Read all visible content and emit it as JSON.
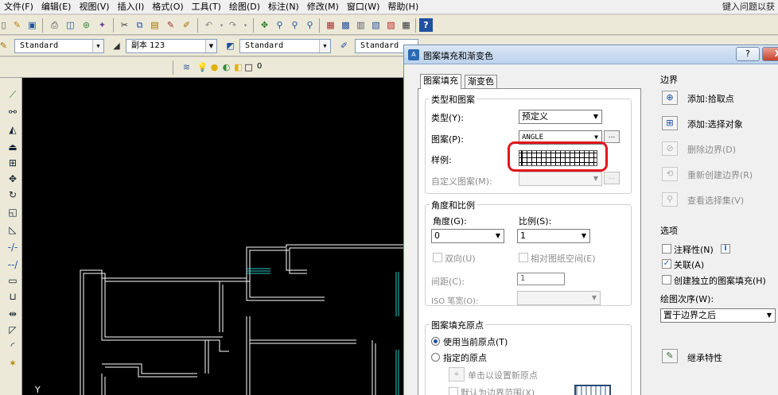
{
  "menu": [
    "文件(F)",
    "编辑(E)",
    "视图(V)",
    "插入(I)",
    "格式(O)",
    "工具(T)",
    "绘图(D)",
    "标注(N)",
    "修改(M)",
    "窗口(W)",
    "帮助(H)"
  ],
  "help_search": "键入问题以获",
  "toolbar2": {
    "text_style": "Standard",
    "dim_style": "副本 123",
    "table_style": "Standard",
    "ml_style": "Standard"
  },
  "layer": {
    "name": "0"
  },
  "canvas": {
    "ucs_label": "Y"
  },
  "dialog": {
    "title": "图案填充和渐变色",
    "help_btn": "?",
    "close_btn": "X",
    "tabs": [
      "图案填充",
      "渐变色"
    ],
    "type_group": {
      "title": "类型和图案",
      "type_label": "类型(Y):",
      "type_value": "预定义",
      "pattern_label": "图案(P):",
      "pattern_value": "ANGLE",
      "browse": "...",
      "sample_label": "样例:",
      "custom_label": "自定义图案(M):",
      "custom_browse": "..."
    },
    "angle_group": {
      "title": "角度和比例",
      "angle_label": "角度(G):",
      "angle_value": "0",
      "scale_label": "比例(S):",
      "scale_value": "1",
      "double_label": "双向(U)",
      "relative_label": "相对图纸空间(E)",
      "spacing_label": "间距(C):",
      "spacing_value": "1",
      "iso_label": "ISO 笔宽(O):"
    },
    "origin_group": {
      "title": "图案填充原点",
      "use_current": "使用当前原点(T)",
      "specified": "指定的原点",
      "click_set": "单击以设置新原点",
      "default_extents": "默认为边界范围(X)"
    },
    "boundary": {
      "title": "边界",
      "add_pick": "添加:拾取点",
      "add_select": "添加:选择对象",
      "remove": "删除边界(D)",
      "recreate": "重新创建边界(R)",
      "view_sel": "查看选择集(V)"
    },
    "options": {
      "title": "选项",
      "annotative": "注释性(N)",
      "info": "i",
      "associative": "关联(A)",
      "create_separate": "创建独立的图案填充(H)",
      "draw_order_label": "绘图次序(W):",
      "draw_order_value": "置于边界之后"
    },
    "inherit": "继承特性"
  }
}
